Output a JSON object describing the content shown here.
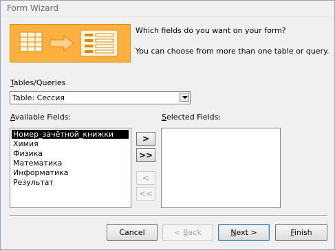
{
  "window": {
    "title": "Form Wizard"
  },
  "header": {
    "question": "Which fields do you want on your form?",
    "hint": "You can choose from more than one table or query."
  },
  "tables_queries": {
    "label_underlined": "T",
    "label_rest": "ables/Queries",
    "selected": "Table: Сессия"
  },
  "available_fields": {
    "label_underlined": "A",
    "label_rest": "vailable Fields:",
    "items": [
      "Номер_зачётной_книжки",
      "Химия",
      "Физика",
      "Математика",
      "Информатика",
      "Результат"
    ],
    "selected_index": 0
  },
  "selected_fields": {
    "label_underlined": "S",
    "label_rest": "elected Fields:",
    "items": []
  },
  "move_buttons": {
    "add_one": ">",
    "add_all": ">>",
    "remove_one": "<",
    "remove_all": "<<"
  },
  "footer": {
    "cancel": "Cancel",
    "back_prefix": "< ",
    "back_underlined": "B",
    "back_rest": "ack",
    "next_underlined": "N",
    "next_rest": "ext >",
    "finish_underlined": "F",
    "finish_rest": "inish"
  }
}
